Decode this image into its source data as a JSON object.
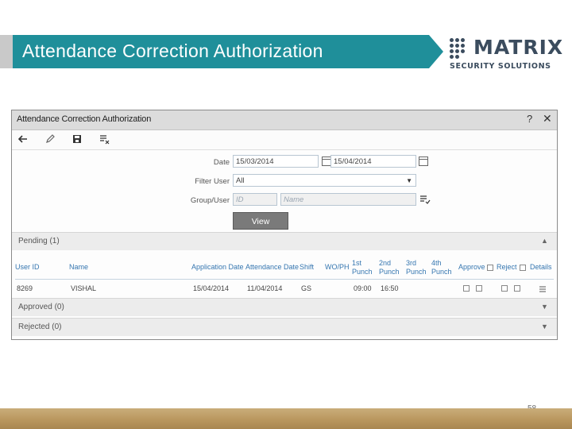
{
  "slide": {
    "title": "Attendance Correction Authorization",
    "page_number": "58",
    "colors": {
      "banner": "#1f8f9a",
      "banner_side": "#c9c9c9",
      "footer": "#b8955c"
    }
  },
  "logo": {
    "word": "MATRIX",
    "subtitle": "SECURITY SOLUTIONS",
    "icon": "matrix-dots-logo"
  },
  "window": {
    "title": "Attendance Correction Authorization",
    "help_label": "?",
    "close_label": "✕"
  },
  "toolbar": {
    "icons": [
      "back-arrow-icon",
      "edit-pencil-icon",
      "save-disk-icon",
      "clear-list-icon"
    ]
  },
  "filters": {
    "date_label": "Date",
    "date_from": "15/03/2014",
    "date_to": "15/04/2014",
    "filter_user_label": "Filter User",
    "filter_user_value": "All",
    "group_user_label": "Group/User",
    "id_placeholder": "ID",
    "name_placeholder": "Name",
    "view_button": "View"
  },
  "pending": {
    "title": "Pending (1)",
    "columns": [
      "User ID",
      "Name",
      "Application Date",
      "Attendance Date",
      "Shift",
      "WO/PH",
      "1st Punch",
      "2nd Punch",
      "3rd Punch",
      "4th Punch",
      "Approve",
      "Reject",
      "Details"
    ],
    "rows": [
      {
        "user_id": "8269",
        "name": "VISHAL",
        "application_date": "15/04/2014",
        "attendance_date": "11/04/2014",
        "shift": "GS",
        "wo_ph": "",
        "punch1": "09:00",
        "punch2": "16:50",
        "punch3": "",
        "punch4": ""
      }
    ]
  },
  "approved": {
    "title": "Approved (0)"
  },
  "rejected": {
    "title": "Rejected (0)"
  }
}
